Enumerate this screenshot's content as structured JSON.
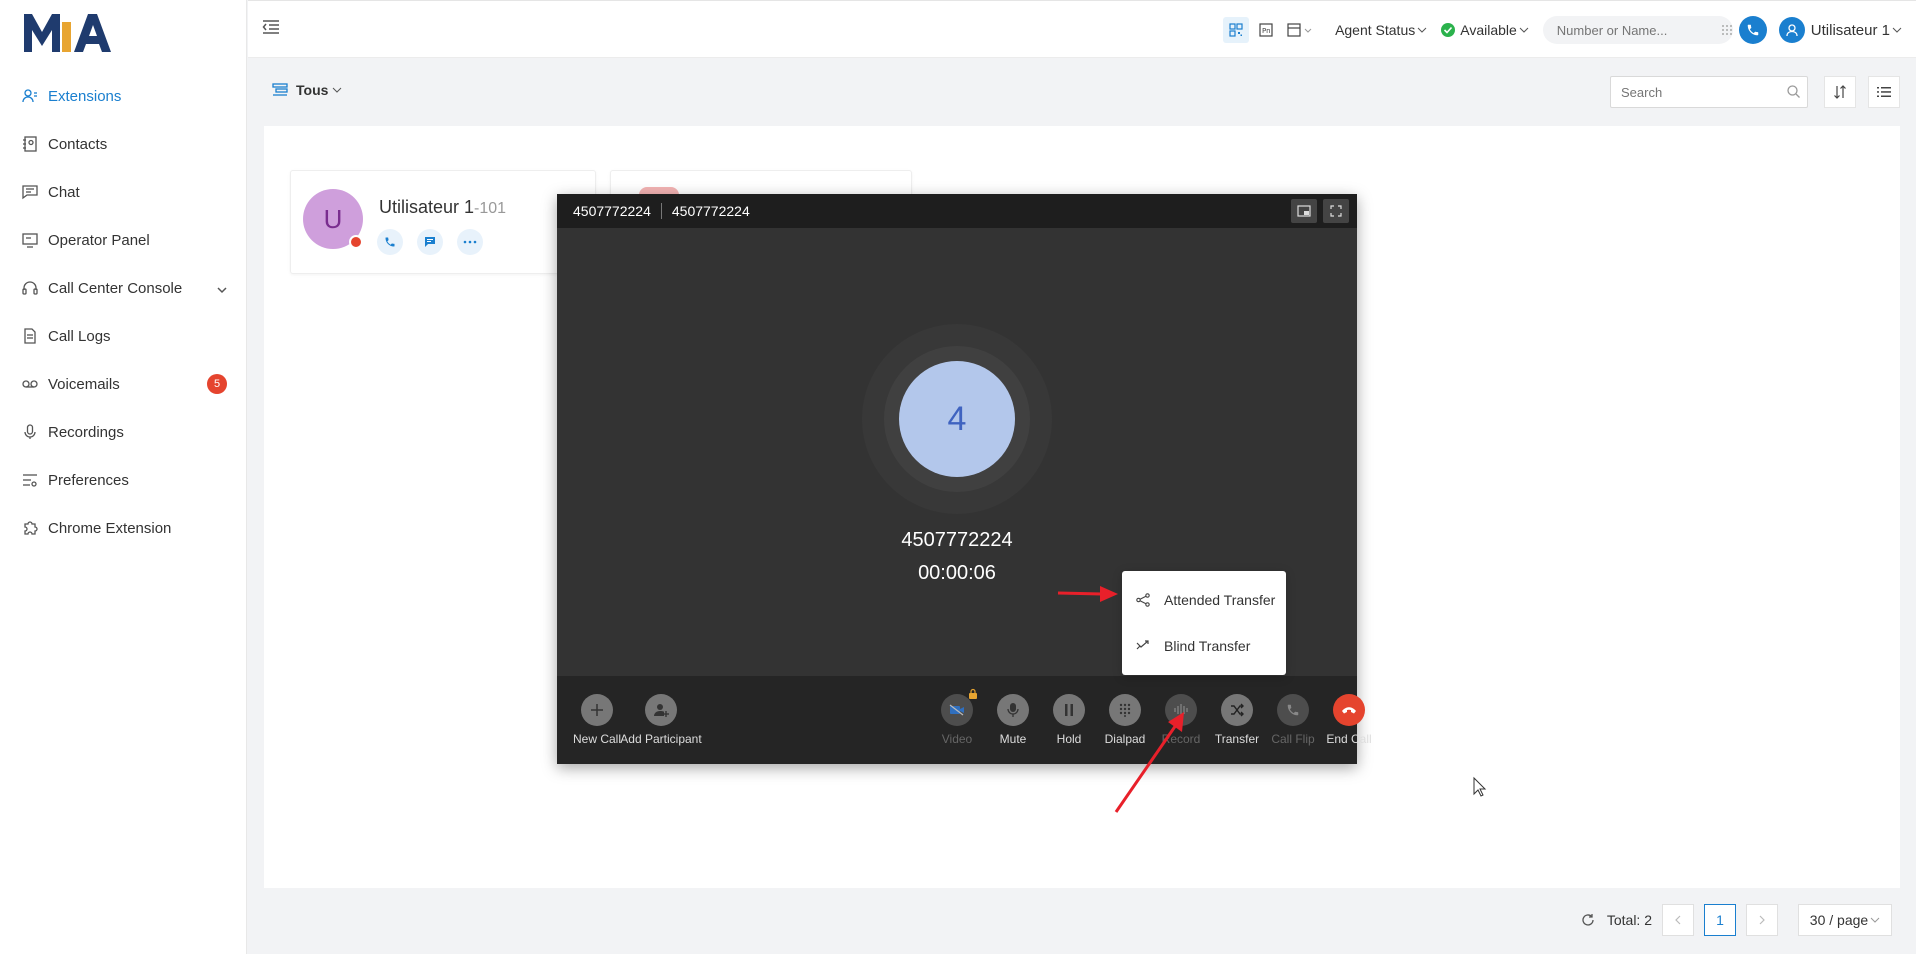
{
  "app": {
    "logo_text": "MIA"
  },
  "sidebar": {
    "items": [
      {
        "label": "Extensions",
        "icon": "user-list-icon",
        "active": true
      },
      {
        "label": "Contacts",
        "icon": "contacts-book-icon"
      },
      {
        "label": "Chat",
        "icon": "chat-bubble-icon"
      },
      {
        "label": "Operator Panel",
        "icon": "monitor-icon"
      },
      {
        "label": "Call Center Console",
        "icon": "headset-icon",
        "expandable": true
      },
      {
        "label": "Call Logs",
        "icon": "document-icon"
      },
      {
        "label": "Voicemails",
        "icon": "voicemail-icon",
        "badge": "5"
      },
      {
        "label": "Recordings",
        "icon": "microphone-icon"
      },
      {
        "label": "Preferences",
        "icon": "sliders-icon"
      },
      {
        "label": "Chrome Extension",
        "icon": "puzzle-icon"
      }
    ]
  },
  "header": {
    "agent_status_label": "Agent Status",
    "availability_label": "Available",
    "dial_placeholder": "Number or Name...",
    "user_label": "Utilisateur 1"
  },
  "toolbar": {
    "filter_label": "Tous",
    "search_placeholder": "Search"
  },
  "extensions": [
    {
      "avatar_letter": "U",
      "name": "Utilisateur 1",
      "number": "-101",
      "avatar_color": "#cf9fdc",
      "status_color": "#e5442e"
    }
  ],
  "call": {
    "title_left": "4507772224",
    "title_right": "4507772224",
    "avatar_label": "4",
    "caller_number": "4507772224",
    "timer": "00:00:06",
    "left_buttons": [
      {
        "label": "New Call",
        "icon": "plus-icon"
      },
      {
        "label": "Add Participant",
        "icon": "add-person-icon"
      }
    ],
    "right_buttons": [
      {
        "label": "Video",
        "icon": "video-off-icon",
        "disabled": true
      },
      {
        "label": "Mute",
        "icon": "microphone-icon"
      },
      {
        "label": "Hold",
        "icon": "pause-icon"
      },
      {
        "label": "Dialpad",
        "icon": "dialpad-icon"
      },
      {
        "label": "Record",
        "icon": "waveform-icon",
        "disabled": true
      },
      {
        "label": "Transfer",
        "icon": "transfer-icon"
      },
      {
        "label": "Call Flip",
        "icon": "call-flip-icon",
        "disabled": true
      },
      {
        "label": "End Call",
        "icon": "hangup-icon",
        "end": true
      }
    ]
  },
  "transfer_menu": {
    "attended_label": "Attended Transfer",
    "blind_label": "Blind Transfer"
  },
  "pagination": {
    "total_label": "Total: 2",
    "current_page": "1",
    "page_size_label": "30 / page"
  },
  "colors": {
    "accent": "#1a7fcf",
    "end_call": "#e5442e",
    "annotation_arrow": "#e8202a"
  }
}
